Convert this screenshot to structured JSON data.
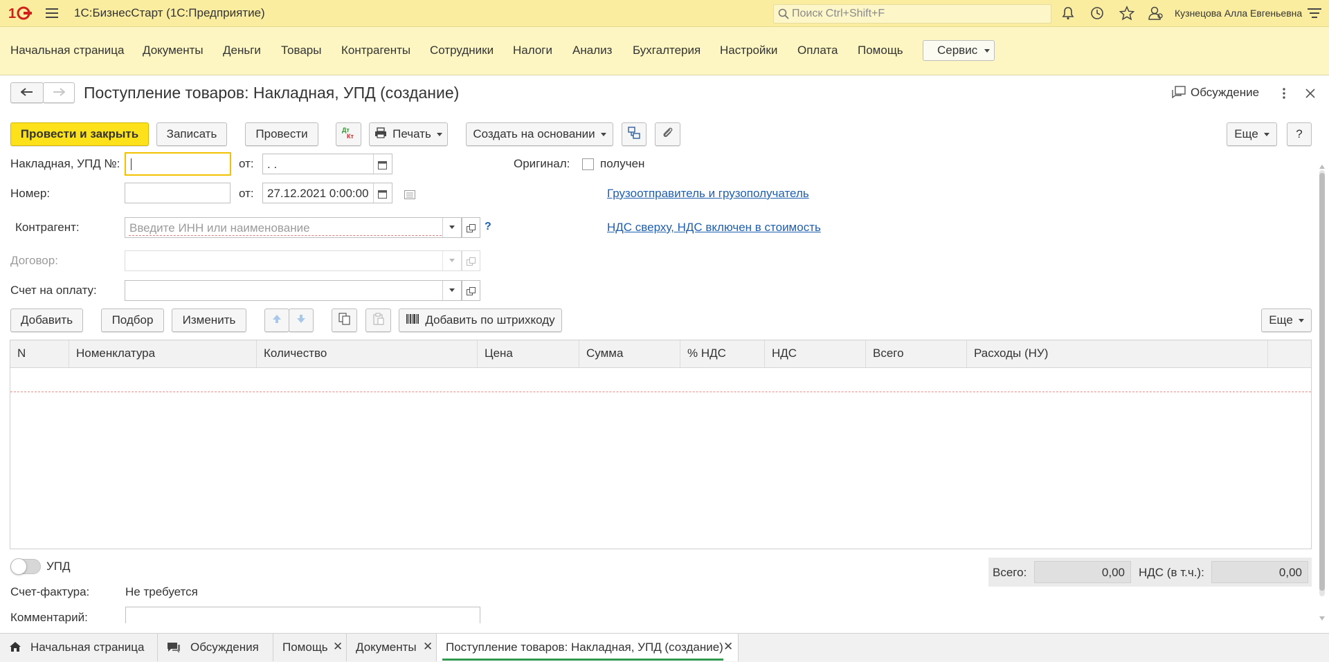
{
  "app": {
    "title": "1С:БизнесСтарт  (1С:Предприятие)",
    "search_placeholder": "Поиск Ctrl+Shift+F",
    "user": "Кузнецова Алла Евгеньевна"
  },
  "sections": {
    "items": [
      "Начальная страница",
      "Документы",
      "Деньги",
      "Товары",
      "Контрагенты",
      "Сотрудники",
      "Налоги",
      "Анализ",
      "Бухгалтерия",
      "Настройки",
      "Оплата",
      "Помощь"
    ],
    "service": "Сервис"
  },
  "form": {
    "title": "Поступление товаров: Накладная, УПД (создание)",
    "discussion": "Обсуждение",
    "toolbar": {
      "post_close": "Провести и закрыть",
      "save": "Записать",
      "post": "Провести",
      "print": "Печать",
      "create_based": "Создать на основании",
      "more": "Еще",
      "help": "?"
    },
    "fields": {
      "invoice_label": "Накладная, УПД №:",
      "invoice_value": "",
      "from_label": "от:",
      "invoice_date": " .  .",
      "original_label": "Оригинал:",
      "received_label": "получен",
      "number_label": "Номер:",
      "number_value": "",
      "doc_date": "27.12.2021  0:00:00",
      "counterparty_label": "Контрагент:",
      "counterparty_placeholder": "Введите ИНН или наименование",
      "question": "?",
      "contract_label": "Договор:",
      "invoice_payment_label": "Счет на оплату:"
    },
    "links": {
      "shipper": "Грузоотправитель и грузополучатель",
      "vat": "НДС сверху, НДС включен в стоимость"
    },
    "table_toolbar": {
      "add": "Добавить",
      "pick": "Подбор",
      "change": "Изменить",
      "add_barcode": "Добавить по штрихкоду",
      "more": "Еще"
    },
    "table": {
      "columns": [
        "N",
        "Номенклатура",
        "Количество",
        "Цена",
        "Сумма",
        "% НДС",
        "НДС",
        "Всего",
        "Расходы (НУ)"
      ],
      "rows": []
    },
    "bottom": {
      "upd_label": "УПД",
      "invoice_label": "Счет-фактура:",
      "invoice_value": "Не требуется",
      "comment_label": "Комментарий:",
      "total_label": "Всего:",
      "total_value": "0,00",
      "vat_label": "НДС (в т.ч.):",
      "vat_value": "0,00"
    }
  },
  "tabs": [
    {
      "label": "Начальная страница",
      "closable": false
    },
    {
      "label": "Обсуждения",
      "closable": false
    },
    {
      "label": "Помощь",
      "closable": true
    },
    {
      "label": "Документы",
      "closable": true
    },
    {
      "label": "Поступление товаров: Накладная, УПД (создание)",
      "closable": true,
      "active": true
    }
  ],
  "colors": {
    "topbar": "#fbeda0",
    "sections": "#fdf6c2",
    "primary_button": "#fce11b",
    "link": "#1f5fb0"
  }
}
